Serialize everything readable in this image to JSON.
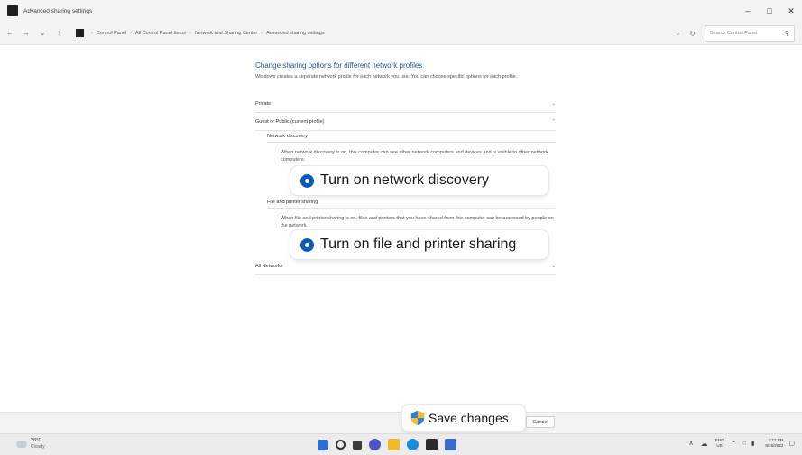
{
  "window": {
    "title": "Advanced sharing settings",
    "minimize": "–",
    "maximize": "□",
    "close": "✕"
  },
  "address_bar": {
    "back": "←",
    "forward": "→",
    "history": "⌄",
    "up": "↑",
    "breadcrumbs": [
      "Control Panel",
      "All Control Panel Items",
      "Network and Sharing Center",
      "Advanced sharing settings"
    ],
    "separator": "›",
    "dropdown": "⌄",
    "refresh": "↻",
    "search_placeholder": "Search Control Panel",
    "search_glyph": "⚲"
  },
  "content": {
    "heading": "Change sharing options for different network profiles",
    "description": "Windows creates a separate network profile for each network you use. You can choose specific options for each profile.",
    "sections": {
      "private": "Private",
      "guest_public": "Guest or Public (current profile)",
      "all_networks": "All Networks"
    },
    "chevron_down": "⌄",
    "chevron_up": "⌃",
    "network_discovery": {
      "label": "Network discovery",
      "description": "When network discovery is on, this computer can see other network computers and devices and is visible to other network computers.",
      "option": "Turn on network discovery"
    },
    "file_printer_sharing": {
      "label": "File and printer sharing",
      "description": "When file and printer sharing is on, files and printers that you have shared from this computer can be accessed by people on the network.",
      "option": "Turn on file and printer sharing"
    }
  },
  "actions": {
    "save": "Save changes",
    "cancel": "Cancel"
  },
  "taskbar": {
    "weather_temp": "28°C",
    "weather_condition": "Cloudy",
    "tray_chevron": "∧",
    "cloud": "☁",
    "lang_top": "ENG",
    "lang_bottom": "US",
    "status_icons": "⌔ ◁ ▮",
    "time": "2:17 PM",
    "date": "8/26/2022",
    "notification": "▢"
  },
  "colors": {
    "accent": "#0c5ab8",
    "heading_link": "#1e5a9a",
    "shield_blue": "#2f7de1",
    "shield_yellow": "#f5c01a"
  }
}
